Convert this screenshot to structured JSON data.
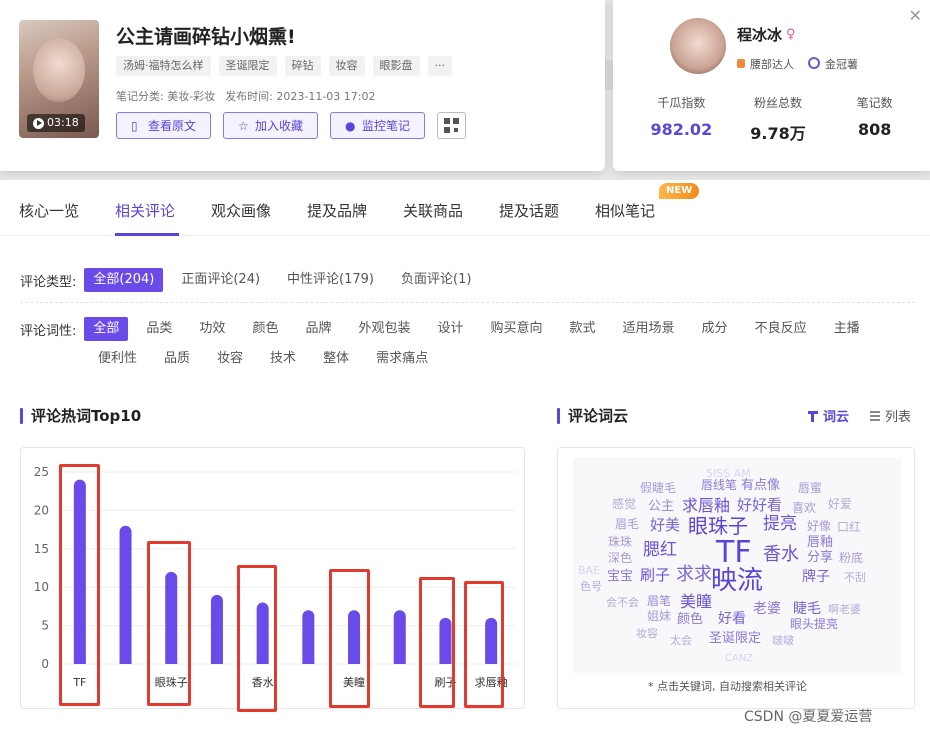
{
  "note": {
    "duration": "03:18",
    "title": "公主请画碎钻小烟熏!",
    "tags": [
      "汤姆·福特怎么样",
      "圣诞限定",
      "碎钻",
      "妆容",
      "眼影盘",
      "···"
    ],
    "category": "笔记分类: 美妆-彩妆",
    "publish_time": "发布时间: 2023-11-03 17:02",
    "buttons": {
      "view_original": "查看原文",
      "add_favorite": "加入收藏",
      "monitor": "监控笔记"
    }
  },
  "user": {
    "name": "程冰冰",
    "gender": "♀",
    "badges": [
      "腰部达人",
      "金冠薯"
    ],
    "stats": [
      {
        "label": "千瓜指数",
        "value": "982.02"
      },
      {
        "label": "粉丝总数",
        "value": "9.78万"
      },
      {
        "label": "笔记数",
        "value": "808"
      }
    ]
  },
  "tabs": [
    "核心一览",
    "相关评论",
    "观众画像",
    "提及品牌",
    "关联商品",
    "提及话题",
    "相似笔记"
  ],
  "new_badge": "NEW",
  "comment_type": {
    "label": "评论类型:",
    "options": [
      "全部(204)",
      "正面评论(24)",
      "中性评论(179)",
      "负面评论(1)"
    ]
  },
  "comment_pos": {
    "label": "评论词性:",
    "row1": [
      "全部",
      "品类",
      "功效",
      "颜色",
      "品牌",
      "外观包装",
      "设计",
      "购买意向",
      "款式",
      "适用场景",
      "成分",
      "不良反应",
      "主播"
    ],
    "row2": [
      "便利性",
      "品质",
      "妆容",
      "技术",
      "整体",
      "需求痛点"
    ]
  },
  "sections": {
    "top10": "评论热词Top10",
    "cloud": "评论词云",
    "cloud_view": "词云",
    "list_view": "列表"
  },
  "chart_data": {
    "type": "bar",
    "title": "评论热词Top10",
    "categories": [
      "TF",
      "",
      "眼珠子",
      "",
      "香水",
      "",
      "美瞳",
      "",
      "刷子",
      "求唇釉"
    ],
    "values": [
      24,
      18,
      12,
      9,
      8,
      7,
      7,
      7,
      6,
      6
    ],
    "yticks": [
      "0",
      "5",
      "10",
      "15",
      "20",
      "25"
    ],
    "ylim": [
      0,
      25
    ],
    "color": "#6a4ae8",
    "grid": true
  },
  "cloud_words": [
    {
      "text": "5ISS AM",
      "size": 11,
      "color": "#d8d4ec"
    },
    {
      "text": "假睫毛",
      "size": 12,
      "color": "#a89ad8"
    },
    {
      "text": "唇线笔",
      "size": 12,
      "color": "#8a7ad8"
    },
    {
      "text": "有点像",
      "size": 13,
      "color": "#8a7ad8"
    },
    {
      "text": "唇蜜",
      "size": 12,
      "color": "#a89ad8"
    },
    {
      "text": "感觉",
      "size": 12,
      "color": "#b4aad8"
    },
    {
      "text": "公主",
      "size": 13,
      "color": "#9a8ad8"
    },
    {
      "text": "求唇釉",
      "size": 16,
      "color": "#6a54d8"
    },
    {
      "text": "好好看",
      "size": 15,
      "color": "#7a64d8"
    },
    {
      "text": "喜欢",
      "size": 12,
      "color": "#a89ad8"
    },
    {
      "text": "好爱",
      "size": 12,
      "color": "#b4aad8"
    },
    {
      "text": "眉毛",
      "size": 12,
      "color": "#a89ad8"
    },
    {
      "text": "好美",
      "size": 15,
      "color": "#7a64d8"
    },
    {
      "text": "眼珠子",
      "size": 20,
      "color": "#5a44d8"
    },
    {
      "text": "提亮",
      "size": 17,
      "color": "#6a54d8"
    },
    {
      "text": "好像",
      "size": 12,
      "color": "#a89ad8"
    },
    {
      "text": "口红",
      "size": 12,
      "color": "#b4aad8"
    },
    {
      "text": "珠珠",
      "size": 12,
      "color": "#a89ad8"
    },
    {
      "text": "唇釉",
      "size": 13,
      "color": "#8a7ad8"
    },
    {
      "text": "深色",
      "size": 12,
      "color": "#a89ad8"
    },
    {
      "text": "腮红",
      "size": 17,
      "color": "#6a54d8"
    },
    {
      "text": "TF",
      "size": 30,
      "color": "#5a44d8"
    },
    {
      "text": "香水",
      "size": 18,
      "color": "#6a54d8"
    },
    {
      "text": "分享",
      "size": 13,
      "color": "#8a7ad8"
    },
    {
      "text": "粉底",
      "size": 12,
      "color": "#a89ad8"
    },
    {
      "text": "BAE",
      "size": 11,
      "color": "#d8d4ec"
    },
    {
      "text": "宝宝",
      "size": 13,
      "color": "#8a7ad8"
    },
    {
      "text": "刷子",
      "size": 15,
      "color": "#6a54d8"
    },
    {
      "text": "求求",
      "size": 18,
      "color": "#7a64d8"
    },
    {
      "text": "映流",
      "size": 26,
      "color": "#5a44d8"
    },
    {
      "text": "牌子",
      "size": 14,
      "color": "#7a64d8"
    },
    {
      "text": "不刮",
      "size": 11,
      "color": "#b4aad8"
    },
    {
      "text": "色号",
      "size": 11,
      "color": "#b4aad8"
    },
    {
      "text": "会不会",
      "size": 11,
      "color": "#b4aad8"
    },
    {
      "text": "眉笔",
      "size": 12,
      "color": "#9a8ad8"
    },
    {
      "text": "美瞳",
      "size": 16,
      "color": "#6a54d8"
    },
    {
      "text": "老婆",
      "size": 14,
      "color": "#8a7ad8"
    },
    {
      "text": "睫毛",
      "size": 14,
      "color": "#7a64d8"
    },
    {
      "text": "啊老婆",
      "size": 11,
      "color": "#b4aad8"
    },
    {
      "text": "姐妹",
      "size": 12,
      "color": "#a89ad8"
    },
    {
      "text": "颜色",
      "size": 13,
      "color": "#8a7ad8"
    },
    {
      "text": "好看",
      "size": 14,
      "color": "#7a64d8"
    },
    {
      "text": "眼头提亮",
      "size": 12,
      "color": "#8a7ad8"
    },
    {
      "text": "妆容",
      "size": 11,
      "color": "#b4aad8"
    },
    {
      "text": "太会",
      "size": 11,
      "color": "#b4aad8"
    },
    {
      "text": "圣诞限定",
      "size": 13,
      "color": "#8a7ad8"
    },
    {
      "text": "啵啵",
      "size": 11,
      "color": "#b4aad8"
    },
    {
      "text": "CANZ",
      "size": 10,
      "color": "#d8d4ec"
    }
  ],
  "cloud_note": "* 点击关键词, 自动搜索相关评论",
  "watermark": "CSDN @夏夏爱运营"
}
